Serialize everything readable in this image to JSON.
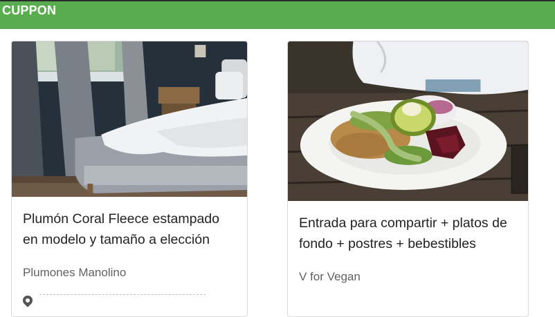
{
  "app": {
    "brand": "CUPPON",
    "colors": {
      "header": "#5aad4e",
      "brand_text": "#ffffff"
    }
  },
  "cards": [
    {
      "image_icon": "bedroom-photo",
      "title": "Plumón Coral Fleece estampado en modelo y tamaño a elección",
      "vendor": "Plumones Manolino",
      "location_icon": "map-pin-icon"
    },
    {
      "image_icon": "vegan-bowl-photo",
      "title": "Entrada para compartir + platos de fondo + postres + bebestibles",
      "vendor": "V for Vegan"
    }
  ]
}
